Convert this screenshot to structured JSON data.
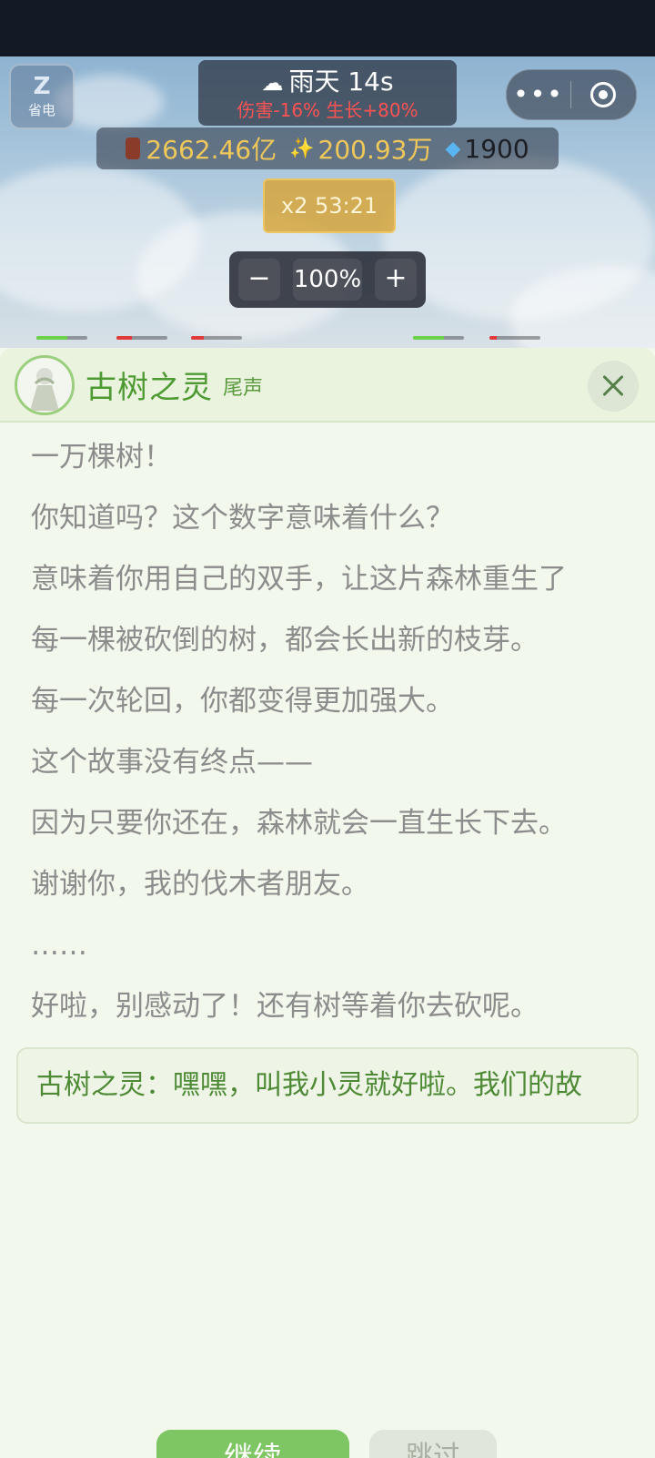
{
  "power_save": {
    "label": "省电"
  },
  "weather": {
    "title": "雨天 14s",
    "effects": "伤害-16% 生长+80%"
  },
  "capsule": {
    "more_icon": "more-dots-icon",
    "close_icon": "target-icon"
  },
  "resources": {
    "wood": "2662.46亿",
    "spark": "200.93万",
    "gems": "1900"
  },
  "boost": {
    "label": "x2 53:21"
  },
  "zoom": {
    "minus": "−",
    "value": "100%",
    "plus": "+"
  },
  "hp_bars": [
    {
      "fill": 0.6,
      "color": "#6bd24a"
    },
    {
      "fill": 0.3,
      "color": "#e23a3a"
    },
    {
      "fill": 0.25,
      "color": "#e23a3a"
    },
    {
      "fill": 0.6,
      "color": "#6bd24a"
    },
    {
      "fill": 0.15,
      "color": "#e23a3a"
    }
  ],
  "dialog": {
    "speaker": "古树之灵",
    "chapter": "尾声",
    "lines": [
      "一万棵树！",
      "你知道吗？这个数字意味着什么？",
      "意味着你用自己的双手，让这片森林重生了",
      "每一棵被砍倒的树，都会长出新的枝芽。",
      "每一次轮回，你都变得更加强大。",
      "这个故事没有终点——",
      "因为只要你还在，森林就会一直生长下去。",
      "谢谢你，我的伐木者朋友。",
      "……",
      "好啦，别感动了！还有树等着你去砍呢。"
    ],
    "quote": "古树之灵：嘿嘿，叫我小灵就好啦。我们的故",
    "continue": "继续",
    "skip": "跳过"
  },
  "colors": {
    "accent_green": "#7ec564",
    "title_green": "#4e9a32",
    "warning_red": "#ff5252",
    "gold": "#f0c85a"
  }
}
